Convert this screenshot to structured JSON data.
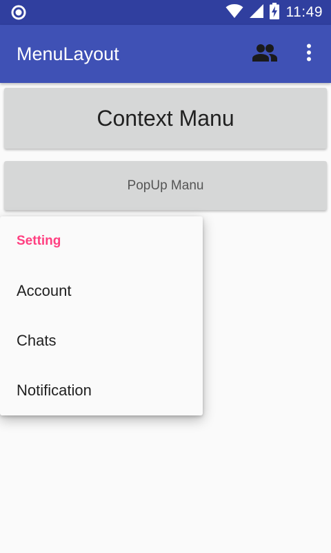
{
  "status_bar": {
    "time": "11:49",
    "icons": [
      "sync-icon",
      "wifi-icon",
      "signal-icon",
      "battery-charging-icon"
    ]
  },
  "app_bar": {
    "title": "MenuLayout",
    "actions": [
      "people-icon",
      "overflow-menu-icon"
    ]
  },
  "buttons": {
    "context_label": "Context Manu",
    "popup_label": "PopUp Manu"
  },
  "popup_menu": {
    "header": "Setting",
    "items": [
      {
        "label": "Account"
      },
      {
        "label": "Chats"
      },
      {
        "label": "Notification"
      }
    ]
  },
  "colors": {
    "status_bar": "#303f9f",
    "app_bar": "#3f51b5",
    "accent": "#ff4081",
    "button_bg": "#d6d7d7",
    "background": "#fafafa"
  }
}
